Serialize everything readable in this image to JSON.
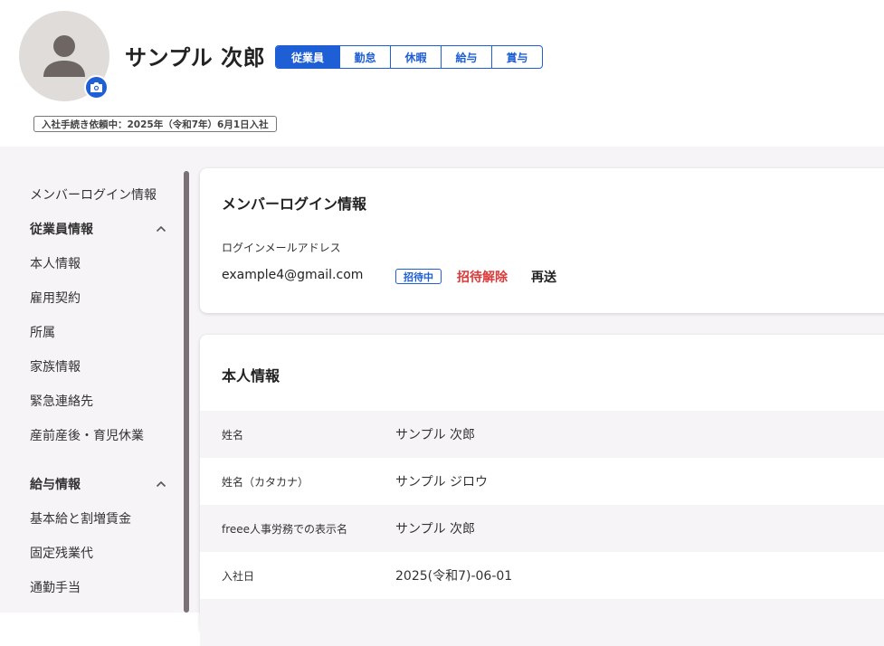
{
  "employee": {
    "name": "サンプル 次郎",
    "status_badge": "入社手続き依頼中：2025年（令和7年）6月1日入社"
  },
  "tabs": [
    {
      "label": "従業員",
      "active": true
    },
    {
      "label": "勤怠",
      "active": false
    },
    {
      "label": "休暇",
      "active": false
    },
    {
      "label": "給与",
      "active": false
    },
    {
      "label": "賞与",
      "active": false
    }
  ],
  "sidebar": {
    "item_login": "メンバーログイン情報",
    "group_employee": "従業員情報",
    "employee_items": [
      "本人情報",
      "雇用契約",
      "所属",
      "家族情報",
      "緊急連絡先",
      "産前産後・育児休業"
    ],
    "group_salary": "給与情報",
    "salary_items": [
      "基本給と割増賃金",
      "固定残業代",
      "通勤手当"
    ]
  },
  "login_card": {
    "title": "メンバーログイン情報",
    "email_label": "ログインメールアドレス",
    "email": "example4@gmail.com",
    "badge": "招待中",
    "cancel_label": "招待解除",
    "resend_label": "再送"
  },
  "personal_card": {
    "title": "本人情報",
    "rows": [
      {
        "label": "姓名",
        "value": "サンプル 次郎"
      },
      {
        "label": "姓名（カタカナ）",
        "value": "サンプル ジロウ"
      },
      {
        "label": "freee人事労務での表示名",
        "value": "サンプル 次郎"
      },
      {
        "label": "入社日",
        "value": "2025(令和7)-06-01"
      }
    ]
  },
  "colors": {
    "accent": "#1f5fd6",
    "danger": "#d93b3b",
    "panel_bg": "#f7f4f7"
  },
  "icons": {
    "avatar": "person-icon",
    "camera": "camera-icon",
    "chevron": "chevron-up-icon"
  }
}
